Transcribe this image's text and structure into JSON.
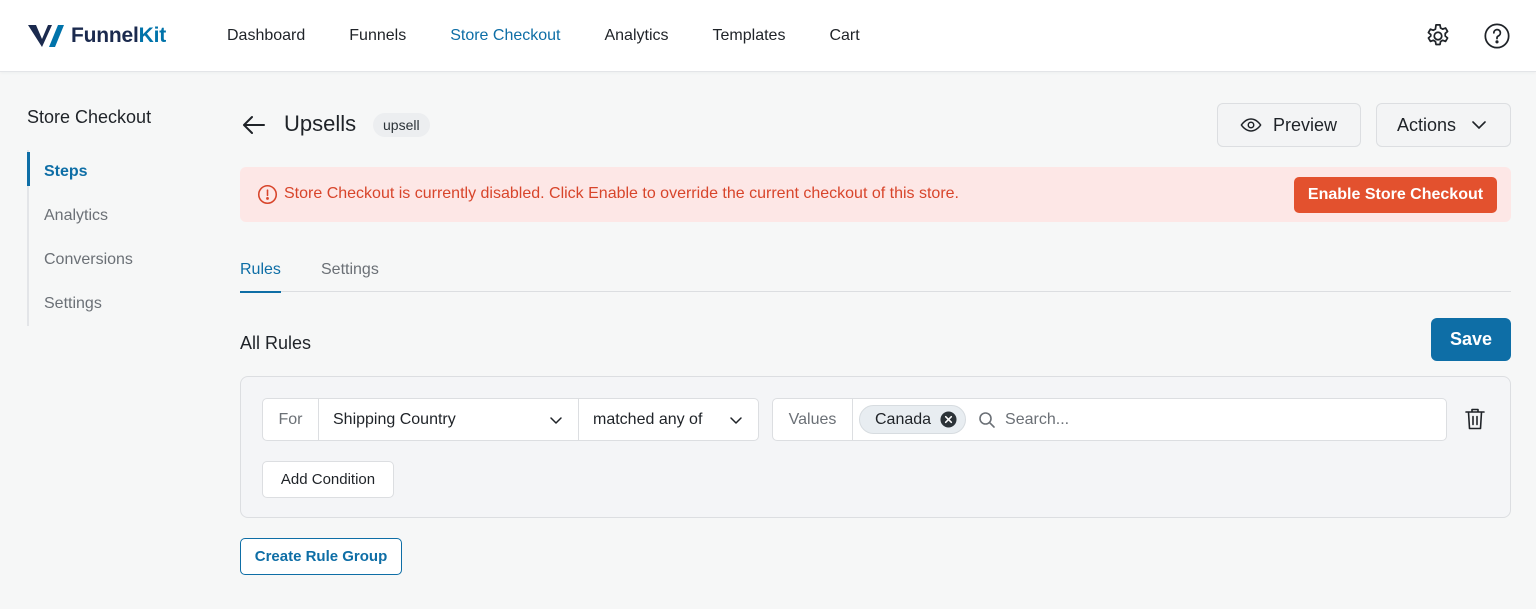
{
  "brand": {
    "name_main": "Funnel",
    "name_accent": "Kit",
    "color_dark": "#1b2a4e",
    "color_accent": "#0073aa"
  },
  "nav": {
    "items": [
      {
        "label": "Dashboard",
        "active": false
      },
      {
        "label": "Funnels",
        "active": false
      },
      {
        "label": "Store Checkout",
        "active": true
      },
      {
        "label": "Analytics",
        "active": false
      },
      {
        "label": "Templates",
        "active": false
      },
      {
        "label": "Cart",
        "active": false
      }
    ],
    "icons": [
      "gear-icon",
      "help-icon"
    ]
  },
  "sidebar": {
    "title": "Store Checkout",
    "items": [
      {
        "label": "Steps",
        "active": true
      },
      {
        "label": "Analytics",
        "active": false
      },
      {
        "label": "Conversions",
        "active": false
      },
      {
        "label": "Settings",
        "active": false
      }
    ]
  },
  "header": {
    "title": "Upsells",
    "tag": "upsell",
    "preview_label": "Preview",
    "actions_label": "Actions"
  },
  "alert": {
    "message": "Store Checkout is currently disabled. Click Enable to override the current checkout of this store.",
    "button_label": "Enable Store Checkout",
    "color": "#d8452b",
    "background": "#fde7e6",
    "button_color": "#e3512e"
  },
  "tabs": [
    {
      "label": "Rules",
      "active": true
    },
    {
      "label": "Settings",
      "active": false
    }
  ],
  "rules": {
    "title": "All Rules",
    "save_label": "Save",
    "condition": {
      "for_label": "For",
      "field": "Shipping Country",
      "operator": "matched any of",
      "values_label": "Values",
      "selected_values": [
        "Canada"
      ],
      "search_placeholder": "Search..."
    },
    "add_condition_label": "Add Condition",
    "create_group_label": "Create Rule Group"
  },
  "colors": {
    "primary": "#0e6ea6"
  }
}
